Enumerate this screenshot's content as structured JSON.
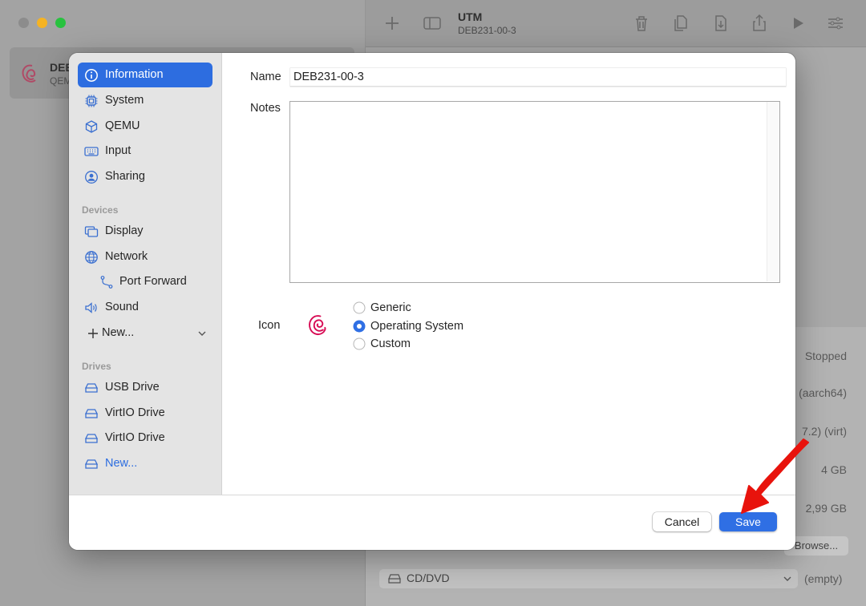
{
  "background_window": {
    "title": "UTM",
    "subtitle": "DEB231-00-3",
    "vm_item": {
      "name": "DEB",
      "sub": "QEM"
    },
    "properties": [
      "Stopped",
      "(aarch64)",
      "7.2) (virt)",
      "4 GB",
      "2,99 GB"
    ],
    "browse_label": "Browse...",
    "cd_label": "CD/DVD",
    "cd_value": "(empty)"
  },
  "sidebar": {
    "items": [
      {
        "label": "Information",
        "icon": "info-icon"
      },
      {
        "label": "System",
        "icon": "cpu-icon"
      },
      {
        "label": "QEMU",
        "icon": "cube-icon"
      },
      {
        "label": "Input",
        "icon": "keyboard-icon"
      },
      {
        "label": "Sharing",
        "icon": "person-icon"
      }
    ],
    "devices_header": "Devices",
    "devices": [
      {
        "label": "Display",
        "icon": "display-icon"
      },
      {
        "label": "Network",
        "icon": "globe-icon"
      },
      {
        "label": "Port Forward",
        "icon": "fork-icon"
      },
      {
        "label": "Sound",
        "icon": "speaker-icon"
      },
      {
        "label": "New...",
        "icon": "plus-icon"
      }
    ],
    "drives_header": "Drives",
    "drives": [
      {
        "label": "USB Drive",
        "icon": "drive-icon"
      },
      {
        "label": "VirtIO Drive",
        "icon": "drive-icon"
      },
      {
        "label": "VirtIO Drive",
        "icon": "drive-icon"
      },
      {
        "label": "New...",
        "icon": "drive-plus-icon"
      }
    ]
  },
  "form": {
    "name_label": "Name",
    "name_value": "DEB231-00-3",
    "notes_label": "Notes",
    "notes_value": "",
    "icon_label": "Icon",
    "icon_options": [
      "Generic",
      "Operating System",
      "Custom"
    ],
    "icon_selected": "Operating System"
  },
  "footer": {
    "cancel_label": "Cancel",
    "save_label": "Save"
  },
  "colors": {
    "accent": "#2d6de0",
    "annotation_arrow": "#e8130c",
    "debian_red": "#d70a53"
  }
}
